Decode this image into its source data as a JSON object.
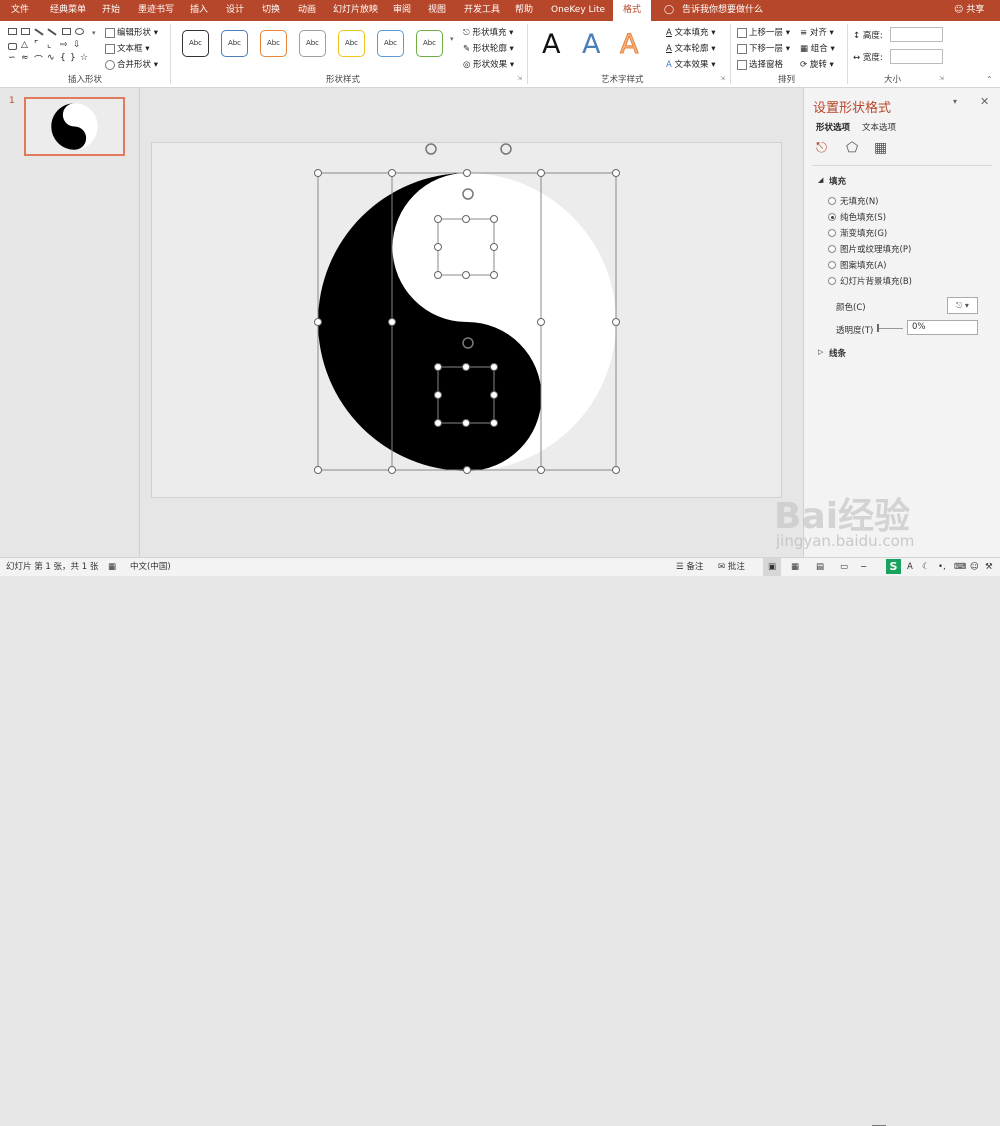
{
  "tabs": [
    "文件",
    "经典菜单",
    "开始",
    "墨迹书写",
    "插入",
    "设计",
    "切换",
    "动画",
    "幻灯片放映",
    "审阅",
    "视图",
    "开发工具",
    "帮助",
    "OneKey Lite",
    "格式"
  ],
  "tell_me": "告诉我你想要做什么",
  "share": "共享",
  "ribbon": {
    "insert_shapes": {
      "edit_shape": "编辑形状",
      "text_box": "文本框",
      "merge_shapes": "合并形状",
      "label": "插入形状"
    },
    "shape_styles": {
      "sample_text": "Abc",
      "fill": "形状填充",
      "outline": "形状轮廓",
      "effects": "形状效果",
      "label": "形状样式"
    },
    "wordart": {
      "sample_letter": "A",
      "text_fill": "文本填充",
      "text_outline": "文本轮廓",
      "text_effects": "文本效果",
      "label": "艺术字样式"
    },
    "arrange": {
      "bring_forward": "上移一层",
      "send_backward": "下移一层",
      "selection_pane": "选择窗格",
      "align": "对齐",
      "group": "组合",
      "rotate": "旋转",
      "label": "排列"
    },
    "size": {
      "height_label": "高度:",
      "width_label": "宽度:",
      "label": "大小"
    }
  },
  "slide_number": "1",
  "pane": {
    "title": "设置形状格式",
    "tab_shape": "形状选项",
    "tab_text": "文本选项",
    "fill_header": "填充",
    "options": [
      "无填充(N)",
      "纯色填充(S)",
      "渐变填充(G)",
      "图片或纹理填充(P)",
      "图案填充(A)",
      "幻灯片背景填充(B)"
    ],
    "selected_option": 1,
    "color_label": "颜色(C)",
    "transparency_label": "透明度(T)",
    "transparency_value": "0%",
    "line_header": "线条"
  },
  "status": {
    "slide_info": "幻灯片 第 1 张，共 1 张",
    "language": "中文(中国)",
    "notes": "备注",
    "comments": "批注"
  },
  "watermark": {
    "brand": "Bai经验",
    "url": "jingyan.baidu.com"
  },
  "colors": {
    "accent": "#b7472a",
    "bg": "#e6e6e6"
  }
}
